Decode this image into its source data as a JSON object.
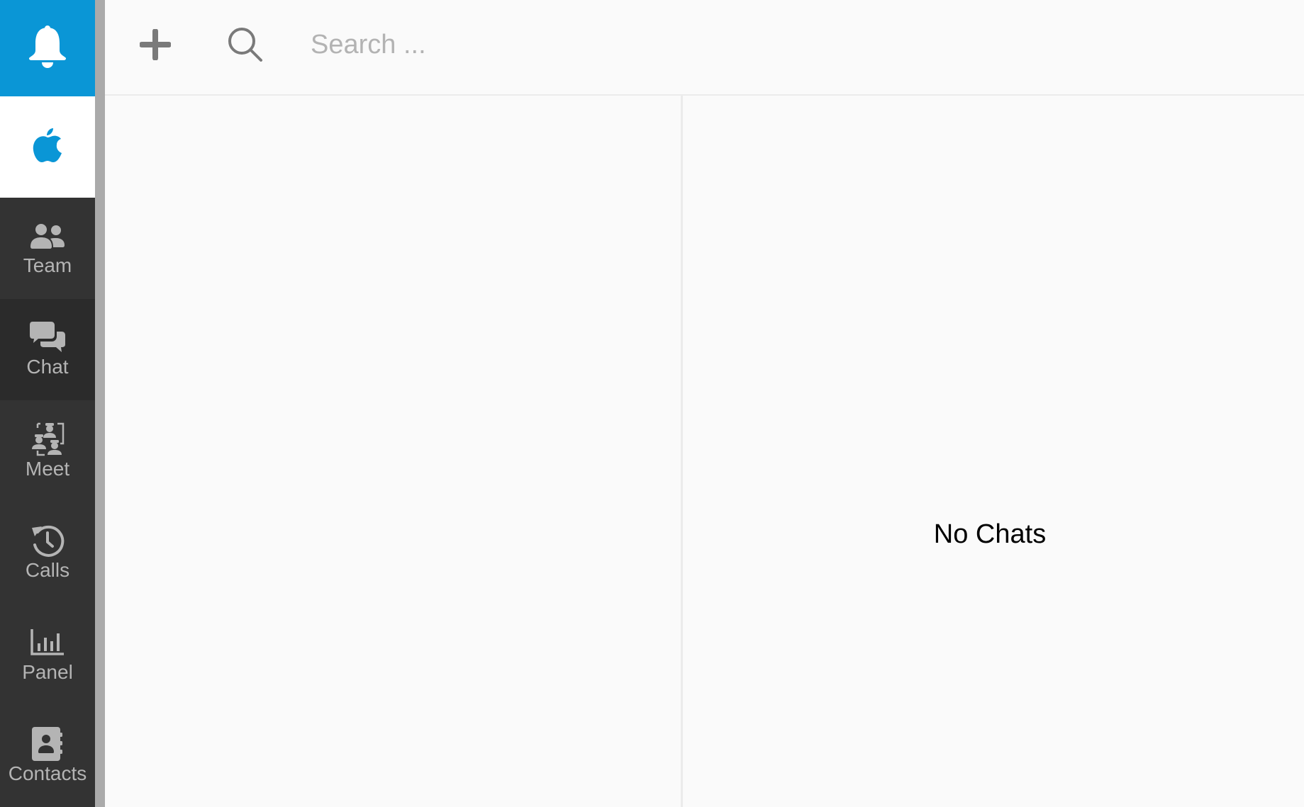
{
  "notifications": {
    "icon": "bell-icon"
  },
  "brand": {
    "icon": "apple-logo-icon",
    "color": "#0a96d6"
  },
  "sidebar": {
    "active": "Chat",
    "items": [
      {
        "id": "team",
        "label": "Team",
        "icon": "team-icon"
      },
      {
        "id": "chat",
        "label": "Chat",
        "icon": "chat-bubbles-icon"
      },
      {
        "id": "meet",
        "label": "Meet",
        "icon": "meeting-icon"
      },
      {
        "id": "calls",
        "label": "Calls",
        "icon": "history-clock-icon"
      },
      {
        "id": "panel",
        "label": "Panel",
        "icon": "bar-chart-icon"
      },
      {
        "id": "contacts",
        "label": "Contacts",
        "icon": "address-book-icon"
      }
    ]
  },
  "header": {
    "add_icon": "plus-icon",
    "search_icon": "search-icon",
    "search": {
      "value": "",
      "placeholder": "Search ..."
    }
  },
  "main": {
    "empty_message": "No Chats"
  },
  "colors": {
    "accent": "#0a96d6",
    "sidebar_bg": "#333333",
    "sidebar_active_bg": "#2b2b2b",
    "sidebar_text": "#b4b4b4"
  }
}
